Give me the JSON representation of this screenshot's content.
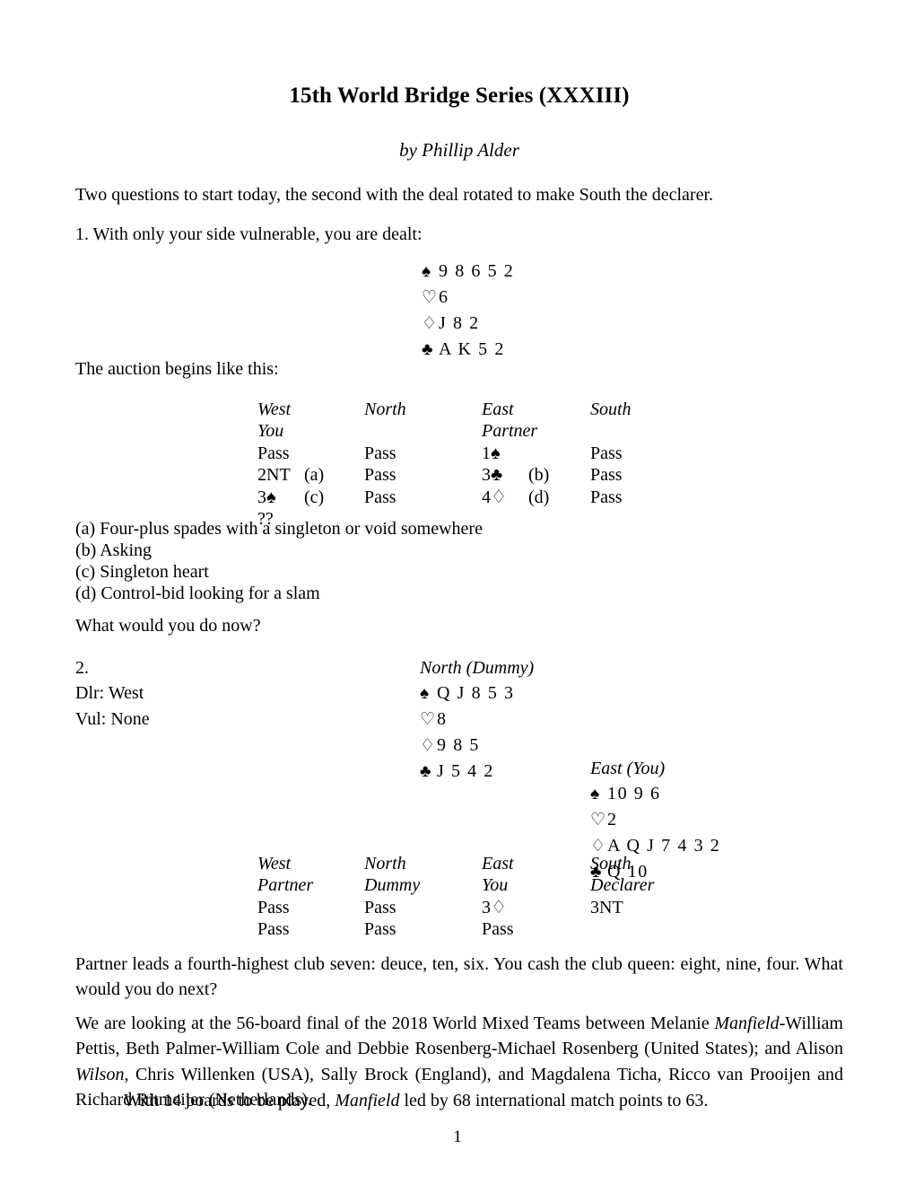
{
  "document": {
    "title": "15th World Bridge Series (XXXIII)",
    "byline": "by Phillip Alder",
    "page_number": "1"
  },
  "intro": {
    "lead": "Two questions to start today, the second with the deal rotated to make South the declarer."
  },
  "question1": {
    "prompt": "1. With only your side vulnerable, you are dealt:",
    "hand": {
      "spades_symbol": "♠",
      "hearts_symbol": "♡",
      "diamonds_symbol": "♢",
      "clubs_symbol": "♣",
      "spades": "9 8 6 5 2",
      "hearts": "6",
      "diamonds": "J 8 2",
      "clubs": "A K 5 2"
    },
    "auction_intro": "The auction begins like this:",
    "auction": {
      "headers": [
        "West",
        "North",
        "East",
        "South"
      ],
      "subheaders": [
        "You",
        "",
        "Partner",
        ""
      ],
      "rows": [
        {
          "west": "Pass",
          "west_note": "",
          "north": "Pass",
          "east": "1♠",
          "east_note": "",
          "south": "Pass"
        },
        {
          "west": "2NT",
          "west_note": "(a)",
          "north": "Pass",
          "east": "3♣",
          "east_note": "(b)",
          "south": "Pass"
        },
        {
          "west": "3♠",
          "west_note": "(c)",
          "north": "Pass",
          "east": "4♢",
          "east_note": "(d)",
          "south": "Pass"
        },
        {
          "west": "??",
          "west_note": "",
          "north": "",
          "east": "",
          "east_note": "",
          "south": ""
        }
      ]
    },
    "footnotes": [
      "(a) Four-plus spades with a singleton or void somewhere",
      "(b) Asking",
      "(c) Singleton heart",
      "(d) Control-bid looking for a slam"
    ],
    "closing_question": "What would you do now?"
  },
  "question2": {
    "number": "2.",
    "dealer": "Dlr: West",
    "vulnerability": "Vul: None",
    "north_hand": {
      "label": "North (Dummy)",
      "spades_symbol": "♠",
      "hearts_symbol": "♡",
      "diamonds_symbol": "♢",
      "clubs_symbol": "♣",
      "spades": "Q J 8 5 3",
      "hearts": "8",
      "diamonds": "9 8 5",
      "clubs": "J 5 4 2"
    },
    "east_hand": {
      "label": "East (You)",
      "spades_symbol": "♠",
      "hearts_symbol": "♡",
      "diamonds_symbol": "♢",
      "clubs_symbol": "♣",
      "spades": "10 9 6",
      "hearts": "2",
      "diamonds": "A Q J 7 4 3 2",
      "clubs": "Q 10"
    },
    "auction": {
      "headers": [
        "West",
        "North",
        "East",
        "South"
      ],
      "subheaders": [
        "Partner",
        "Dummy",
        "You",
        "Declarer"
      ],
      "rows": [
        {
          "west": "Pass",
          "north": "Pass",
          "east": "3♢",
          "south": "3NT"
        },
        {
          "west": "Pass",
          "north": "Pass",
          "east": "Pass",
          "south": ""
        }
      ]
    },
    "play_description": "Partner leads a fourth-highest club seven: deuce, ten, six. You cash the club queen: eight, nine, four. What would you do next?"
  },
  "commentary": {
    "paragraph_1_part_1": "We are looking at the 56-board final of the 2018 World Mixed Teams between Melanie ",
    "paragraph_1_italic_1": "Manfield",
    "paragraph_1_part_2": "-William Pettis, Beth Palmer-William Cole and Debbie Rosenberg-Michael Rosenberg (United States); and Alison ",
    "paragraph_1_italic_2": "Wilson",
    "paragraph_1_part_3": ", Chris Willenken (USA), Sally Brock (England), and Magdalena Ticha, Ricco van Prooijen and Richard Ritmeijer (Netherlands).",
    "paragraph_2_part_1": "With 14 boards to be played, ",
    "paragraph_2_italic_1": "Manfield",
    "paragraph_2_part_2": " led by 68 international match points to 63."
  }
}
